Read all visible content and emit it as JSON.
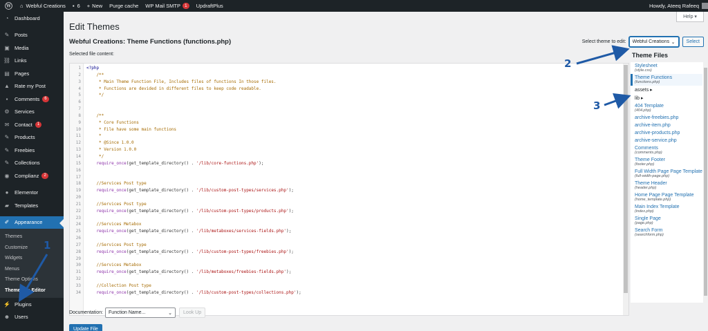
{
  "adminbar": {
    "site_name": "Webful Creations",
    "comments_count": "6",
    "new_label": "New",
    "purge_cache": "Purge cache",
    "wp_mail_smtp": "WP Mail SMTP",
    "wp_mail_smtp_badge": "1",
    "updraftplus": "UpdraftPlus",
    "greeting": "Howdy, Ateeq Rafeeq"
  },
  "sidebar": {
    "items": [
      {
        "label": "Dashboard",
        "icon": "dashboard-icon"
      },
      {
        "label": "Posts",
        "icon": "pin-icon"
      },
      {
        "label": "Media",
        "icon": "media-icon"
      },
      {
        "label": "Links",
        "icon": "link-icon"
      },
      {
        "label": "Pages",
        "icon": "page-icon"
      },
      {
        "label": "Rate my Post",
        "icon": "thumbs-up-icon"
      },
      {
        "label": "Comments",
        "icon": "comment-icon",
        "badge": "6"
      },
      {
        "label": "Services",
        "icon": "gear-icon"
      },
      {
        "label": "Contact",
        "icon": "mail-icon",
        "badge": "1"
      },
      {
        "label": "Products",
        "icon": "pin-icon"
      },
      {
        "label": "Freebies",
        "icon": "pin-icon"
      },
      {
        "label": "Collections",
        "icon": "pin-icon"
      },
      {
        "label": "Complianz",
        "icon": "complianz-icon",
        "badge": "2"
      },
      {
        "label": "Elementor",
        "icon": "elementor-icon"
      },
      {
        "label": "Templates",
        "icon": "folder-icon"
      },
      {
        "label": "Appearance",
        "icon": "brush-icon"
      },
      {
        "label": "Plugins",
        "icon": "plugin-icon"
      },
      {
        "label": "Users",
        "icon": "users-icon"
      }
    ],
    "submenu": [
      "Themes",
      "Customize",
      "Widgets",
      "Menus",
      "Theme Options",
      "Theme File Editor"
    ]
  },
  "help_label": "Help ▾",
  "page_title": "Edit Themes",
  "file_title": "Webful Creations: Theme Functions (functions.php)",
  "selected_label": "Selected file content:",
  "theme_select": {
    "label": "Select theme to edit:",
    "value": "Webful Creations",
    "button": "Select"
  },
  "code_lines": [
    [
      {
        "t": "<?php",
        "c": "kw"
      }
    ],
    [
      {
        "t": "    /**",
        "c": "com"
      }
    ],
    [
      {
        "t": "     * Main Theme Function File, Includes files of functions In those files.",
        "c": "com"
      }
    ],
    [
      {
        "t": "     * Functions are devided in different files to keep code readable.",
        "c": "com"
      }
    ],
    [
      {
        "t": "     */",
        "c": "com"
      }
    ],
    [],
    [],
    [
      {
        "t": "    /**",
        "c": "com"
      }
    ],
    [
      {
        "t": "     * Core Functions",
        "c": "com"
      }
    ],
    [
      {
        "t": "     * File have some main functions",
        "c": "com"
      }
    ],
    [
      {
        "t": "     *",
        "c": "com"
      }
    ],
    [
      {
        "t": "     * @Since 1.0.0",
        "c": "com"
      }
    ],
    [
      {
        "t": "     * Version 1.0.0",
        "c": "com"
      }
    ],
    [
      {
        "t": "     */",
        "c": "com"
      }
    ],
    [
      {
        "t": "    require_once",
        "c": "fn"
      },
      {
        "t": "(get_template_directory() . ",
        "c": "def"
      },
      {
        "t": "'/lib/core-functions.php'",
        "c": "str"
      },
      {
        "t": ");",
        "c": "def"
      }
    ],
    [],
    [],
    [
      {
        "t": "    //Services Post type",
        "c": "com"
      }
    ],
    [
      {
        "t": "    require_once",
        "c": "fn"
      },
      {
        "t": "(get_template_directory() . ",
        "c": "def"
      },
      {
        "t": "'/lib/custom-post-types/services.php'",
        "c": "str"
      },
      {
        "t": ");",
        "c": "def"
      }
    ],
    [],
    [
      {
        "t": "    //Services Post type",
        "c": "com"
      }
    ],
    [
      {
        "t": "    require_once",
        "c": "fn"
      },
      {
        "t": "(get_template_directory() . ",
        "c": "def"
      },
      {
        "t": "'/lib/custom-post-types/products.php'",
        "c": "str"
      },
      {
        "t": ");",
        "c": "def"
      }
    ],
    [],
    [
      {
        "t": "    //Services Metabox",
        "c": "com"
      }
    ],
    [
      {
        "t": "    require_once",
        "c": "fn"
      },
      {
        "t": "(get_template_directory() . ",
        "c": "def"
      },
      {
        "t": "'/lib/metaboxes/services-fields.php'",
        "c": "str"
      },
      {
        "t": ");",
        "c": "def"
      }
    ],
    [],
    [
      {
        "t": "    //Services Post type",
        "c": "com"
      }
    ],
    [
      {
        "t": "    require_once",
        "c": "fn"
      },
      {
        "t": "(get_template_directory() . ",
        "c": "def"
      },
      {
        "t": "'/lib/custom-post-types/freebies.php'",
        "c": "str"
      },
      {
        "t": ");",
        "c": "def"
      }
    ],
    [],
    [
      {
        "t": "    //Services Metabox",
        "c": "com"
      }
    ],
    [
      {
        "t": "    require_once",
        "c": "fn"
      },
      {
        "t": "(get_template_directory() . ",
        "c": "def"
      },
      {
        "t": "'/lib/metaboxes/freebies-fields.php'",
        "c": "str"
      },
      {
        "t": ");",
        "c": "def"
      }
    ],
    [],
    [
      {
        "t": "    //Collection Post type",
        "c": "com"
      }
    ],
    [
      {
        "t": "    require_once",
        "c": "fn"
      },
      {
        "t": "(get_template_directory() . ",
        "c": "def"
      },
      {
        "t": "'/lib/custom-post-types/collections.php'",
        "c": "str"
      },
      {
        "t": ");",
        "c": "def"
      }
    ]
  ],
  "theme_files": {
    "title": "Theme Files",
    "items": [
      {
        "name": "Stylesheet",
        "sub": "(style.css)"
      },
      {
        "name": "Theme Functions",
        "sub": "(functions.php)",
        "current": true
      },
      {
        "name": "assets ▸",
        "dir": true
      },
      {
        "name": "lib ▸",
        "dir": true
      },
      {
        "name": "404 Template",
        "sub": "(404.php)"
      },
      {
        "name": "archive-freebies.php"
      },
      {
        "name": "archive-item.php"
      },
      {
        "name": "archive-products.php"
      },
      {
        "name": "archive-service.php"
      },
      {
        "name": "Comments",
        "sub": "(comments.php)"
      },
      {
        "name": "Theme Footer",
        "sub": "(footer.php)"
      },
      {
        "name": "Full Width Page Page Template",
        "sub": "(full-width-page.php)"
      },
      {
        "name": "Theme Header",
        "sub": "(header.php)"
      },
      {
        "name": "Home Page Page Template",
        "sub": "(home_template.php)"
      },
      {
        "name": "Main Index Template",
        "sub": "(index.php)"
      },
      {
        "name": "Single Page",
        "sub": "(page.php)"
      },
      {
        "name": "Search Form",
        "sub": "(searchform.php)"
      }
    ]
  },
  "documentation": {
    "label": "Documentation:",
    "placeholder": "Function Name...",
    "lookup": "Look Up"
  },
  "update_button": "Update File",
  "annotations": [
    "1",
    "2",
    "3"
  ],
  "colors": {
    "accent": "#2271b1",
    "adminbar": "#1d2327",
    "badge": "#d63638",
    "annotation": "#1f5aa6"
  }
}
